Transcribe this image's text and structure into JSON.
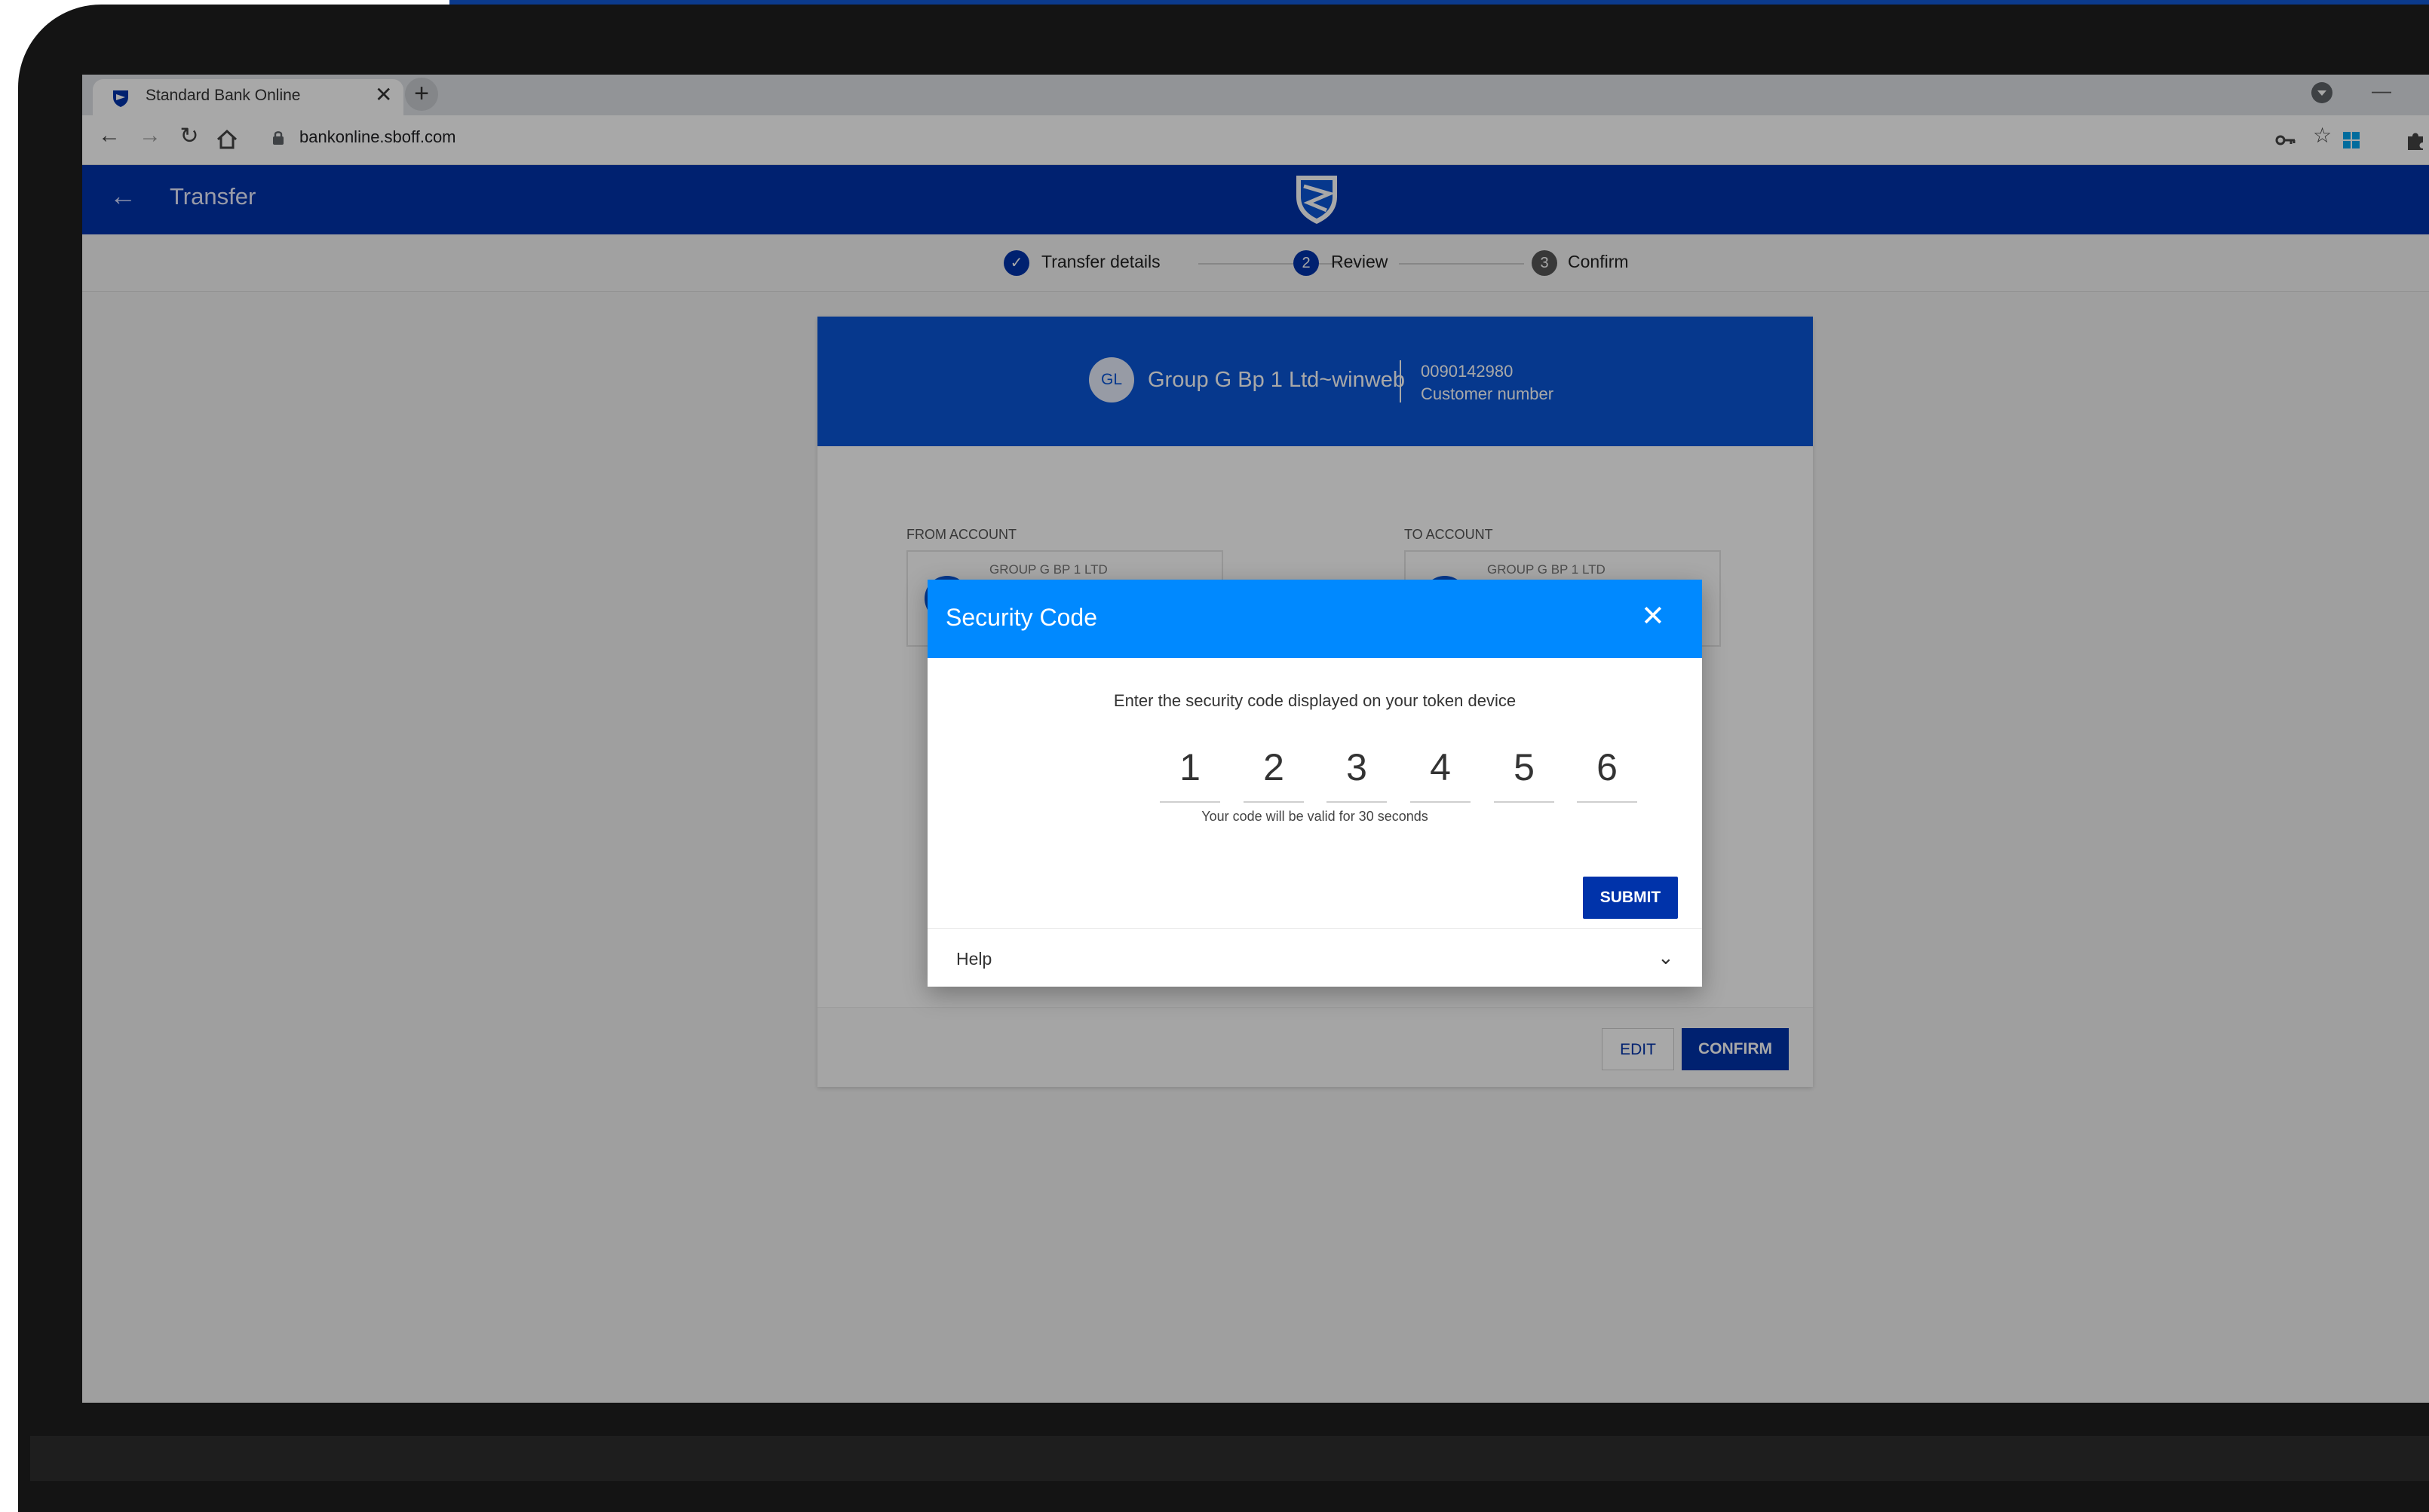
{
  "browser": {
    "tab_title": "Standard Bank Online",
    "tab_close": "✕",
    "new_tab": "+",
    "url": "bankonline.sboff.com",
    "minimize": "—"
  },
  "appbar": {
    "back": "←",
    "title": "Transfer"
  },
  "stepper": {
    "steps": [
      {
        "number": "✓",
        "label": "Transfer details",
        "state": "done"
      },
      {
        "number": "2",
        "label": "Review",
        "state": "active"
      },
      {
        "number": "3",
        "label": "Confirm",
        "state": "pending"
      }
    ]
  },
  "customer": {
    "initials": "GL",
    "name": "Group G Bp 1 Ltd~winweb",
    "number": "0090142980",
    "number_label": "Customer number"
  },
  "accounts": {
    "from_label": "FROM ACCOUNT",
    "from_name": "GROUP G BP 1 LTD",
    "to_label": "TO ACCOUNT",
    "to_name": "GROUP G BP 1 LTD"
  },
  "actions": {
    "edit": "EDIT",
    "confirm": "CONFIRM"
  },
  "modal": {
    "title": "Security Code",
    "close": "✕",
    "instruction": "Enter the security code displayed on your token device",
    "digits": [
      "1",
      "2",
      "3",
      "4",
      "5",
      "6"
    ],
    "validity": "Your code will be valid for 30 seconds",
    "submit": "SUBMIT",
    "help": "Help",
    "help_chevron": "⌄"
  },
  "colors": {
    "brand_blue": "#0033aa",
    "modal_header": "#0089ff",
    "card_header": "#0a56d6"
  }
}
